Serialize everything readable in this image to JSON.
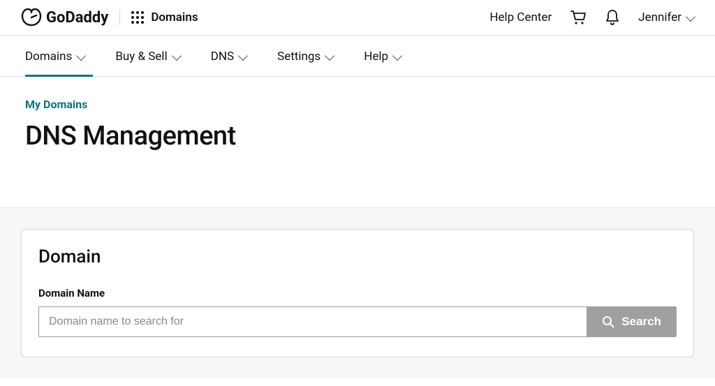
{
  "header": {
    "brand": "GoDaddy",
    "app_label": "Domains",
    "help_center": "Help Center",
    "user_name": "Jennifer"
  },
  "nav": {
    "items": [
      {
        "label": "Domains",
        "active": true
      },
      {
        "label": "Buy & Sell",
        "active": false
      },
      {
        "label": "DNS",
        "active": false
      },
      {
        "label": "Settings",
        "active": false
      },
      {
        "label": "Help",
        "active": false
      }
    ]
  },
  "breadcrumb": "My Domains",
  "page_title": "DNS Management",
  "domain_card": {
    "title": "Domain",
    "field_label": "Domain Name",
    "placeholder": "Domain name to search for",
    "value": "",
    "search_button": "Search"
  }
}
